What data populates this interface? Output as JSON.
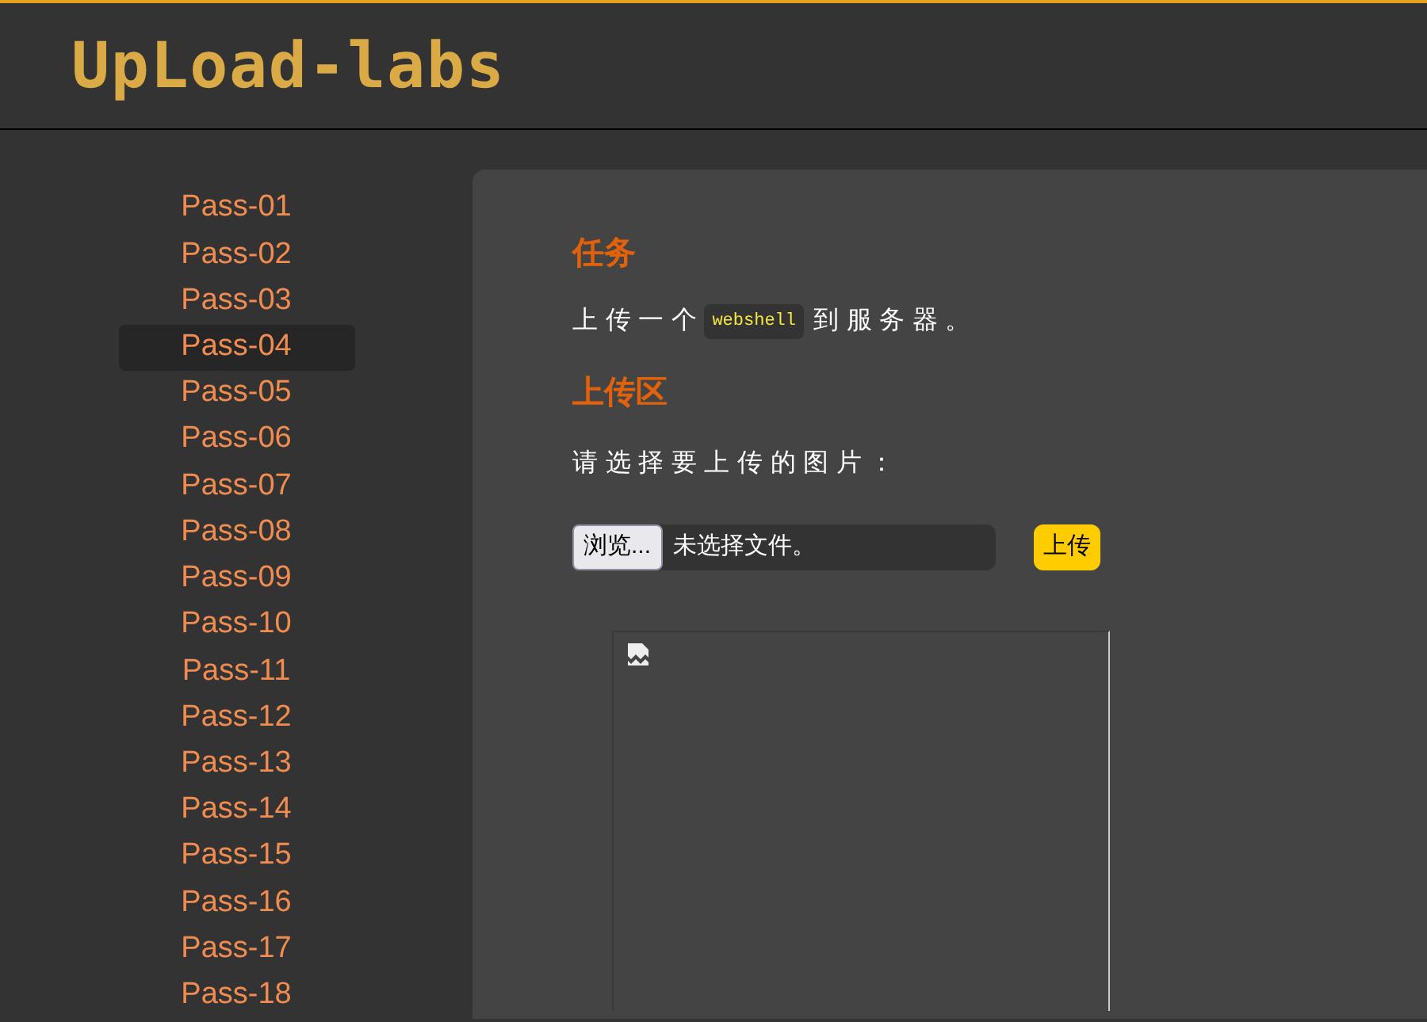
{
  "header": {
    "logo": "UpLoad-labs"
  },
  "sidebar": {
    "items": [
      {
        "label": "Pass-01",
        "selected": false
      },
      {
        "label": "Pass-02",
        "selected": false
      },
      {
        "label": "Pass-03",
        "selected": false
      },
      {
        "label": "Pass-04",
        "selected": true
      },
      {
        "label": "Pass-05",
        "selected": false
      },
      {
        "label": "Pass-06",
        "selected": false
      },
      {
        "label": "Pass-07",
        "selected": false
      },
      {
        "label": "Pass-08",
        "selected": false
      },
      {
        "label": "Pass-09",
        "selected": false
      },
      {
        "label": "Pass-10",
        "selected": false
      },
      {
        "label": "Pass-11",
        "selected": false
      },
      {
        "label": "Pass-12",
        "selected": false
      },
      {
        "label": "Pass-13",
        "selected": false
      },
      {
        "label": "Pass-14",
        "selected": false
      },
      {
        "label": "Pass-15",
        "selected": false
      },
      {
        "label": "Pass-16",
        "selected": false
      },
      {
        "label": "Pass-17",
        "selected": false
      },
      {
        "label": "Pass-18",
        "selected": false
      }
    ]
  },
  "main": {
    "task_heading": "任务",
    "task": {
      "before": "上传一个",
      "code": "webshell",
      "after": "到服务器。"
    },
    "upload_heading": "上传区",
    "prompt": "请选择要上传的图片：",
    "file_input": {
      "button": "浏览...",
      "value": "未选择文件。"
    },
    "submit": "上传"
  }
}
